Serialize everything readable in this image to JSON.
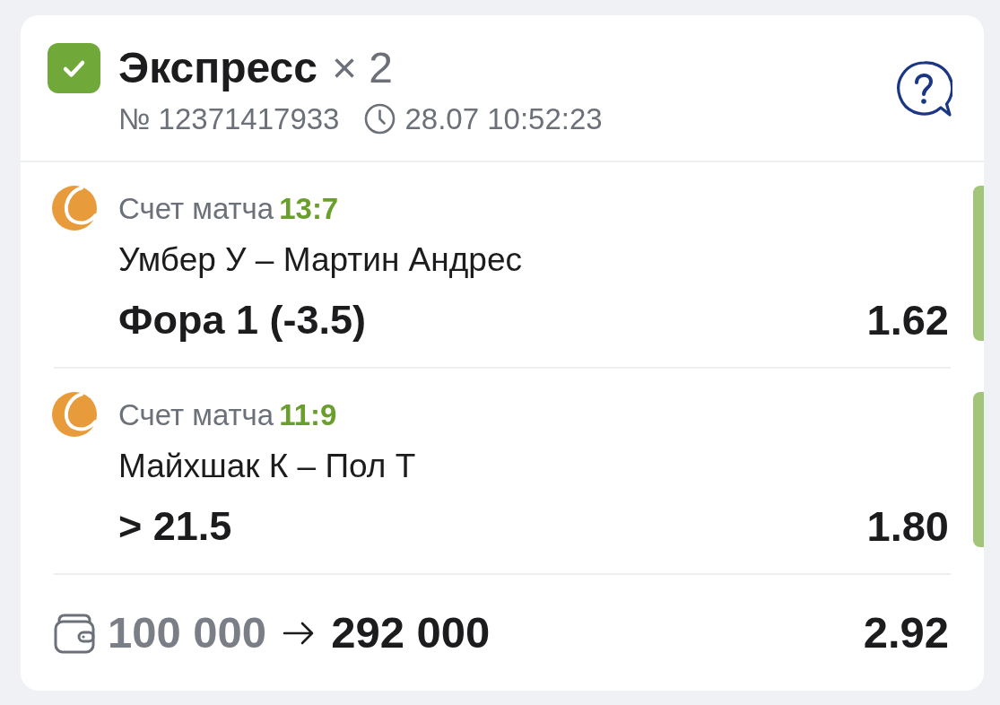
{
  "bet": {
    "won": true,
    "title": "Экспресс",
    "multiplier": "× 2",
    "number": "№ 12371417933",
    "datetime": "28.07 10:52:23"
  },
  "legs": [
    {
      "won": true,
      "label": "Счет матча",
      "score": "13:7",
      "teams": "Умбер У – Мартин Андрес",
      "selection": "Фора 1 (-3.5)",
      "odds": "1.62"
    },
    {
      "won": true,
      "label": "Счет матча",
      "score": "11:9",
      "teams": "Майхшак К – Пол Т",
      "selection": "> 21.5",
      "odds": "1.80"
    }
  ],
  "summary": {
    "stake": "100 000",
    "payout": "292 000",
    "total_odds": "2.92"
  }
}
